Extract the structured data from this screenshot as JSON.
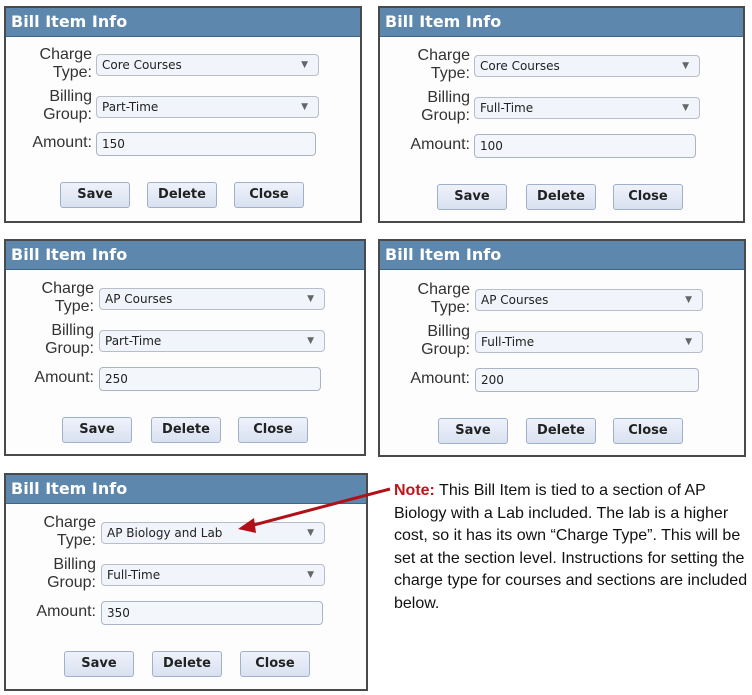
{
  "panels": [
    {
      "title": "Bill Item Info",
      "charge_label": "Charge\nType:",
      "charge_type": "Core Courses",
      "billing_label": "Billing\nGroup:",
      "billing_group": "Part-Time",
      "amount_label": "Amount:",
      "amount": "150",
      "save": "Save",
      "delete": "Delete",
      "close": "Close"
    },
    {
      "title": "Bill Item Info",
      "charge_label": "Charge\nType:",
      "charge_type": "Core Courses",
      "billing_label": "Billing\nGroup:",
      "billing_group": "Full-Time",
      "amount_label": "Amount:",
      "amount": "100",
      "save": "Save",
      "delete": "Delete",
      "close": "Close"
    },
    {
      "title": "Bill Item Info",
      "charge_label": "Charge\nType:",
      "charge_type": "AP Courses",
      "billing_label": "Billing\nGroup:",
      "billing_group": "Part-Time",
      "amount_label": "Amount:",
      "amount": "250",
      "save": "Save",
      "delete": "Delete",
      "close": "Close"
    },
    {
      "title": "Bill Item Info",
      "charge_label": "Charge\nType:",
      "charge_type": "AP Courses",
      "billing_label": "Billing\nGroup:",
      "billing_group": "Full-Time",
      "amount_label": "Amount:",
      "amount": "200",
      "save": "Save",
      "delete": "Delete",
      "close": "Close"
    },
    {
      "title": "Bill Item Info",
      "charge_label": "Charge\nType:",
      "charge_type": "AP Biology and Lab",
      "billing_label": "Billing\nGroup:",
      "billing_group": "Full-Time",
      "amount_label": "Amount:",
      "amount": "350",
      "save": "Save",
      "delete": "Delete",
      "close": "Close"
    }
  ],
  "note": {
    "lead": "Note:",
    "body": " This Bill Item is tied to a section of AP Biology with a Lab included. The lab is a higher cost, so it has its own “Charge Type”. This will be set at the section level. Instructions for setting the charge type for courses and sections are included below."
  },
  "colors": {
    "header": "#5d87ad",
    "note_highlight": "#c0141c",
    "arrow": "#b01018"
  }
}
